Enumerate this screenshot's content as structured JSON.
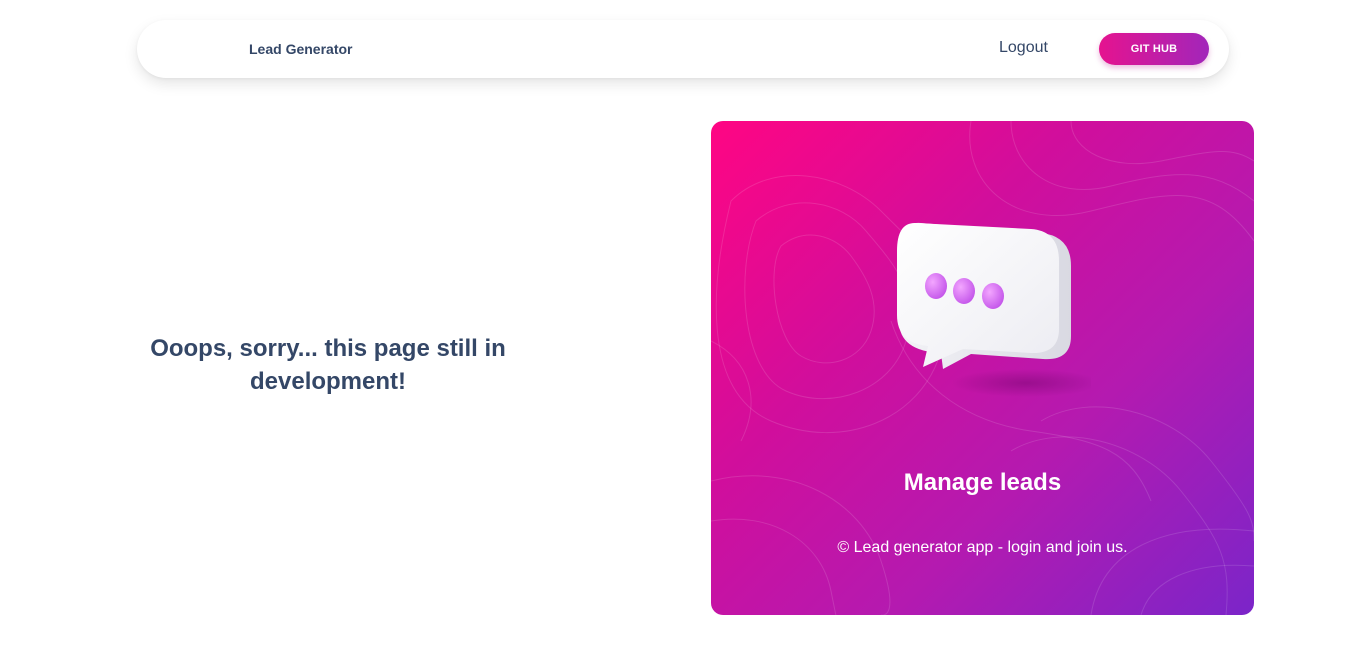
{
  "navbar": {
    "brand": "Lead Generator",
    "logout_label": "Logout",
    "github_label": "GIT HUB"
  },
  "main": {
    "message": "Ooops, sorry... this page still in development!"
  },
  "promo": {
    "title": "Manage leads",
    "caption": "© Lead generator app - login and join us.",
    "illustration_icon": "chat-bubble-icon",
    "gradient_colors": [
      "#ff0583",
      "#b41ab0",
      "#7b25c9"
    ]
  },
  "colors": {
    "text_dark": "#344767",
    "accent_pink": "#e5138f",
    "accent_purple": "#a226ba"
  }
}
